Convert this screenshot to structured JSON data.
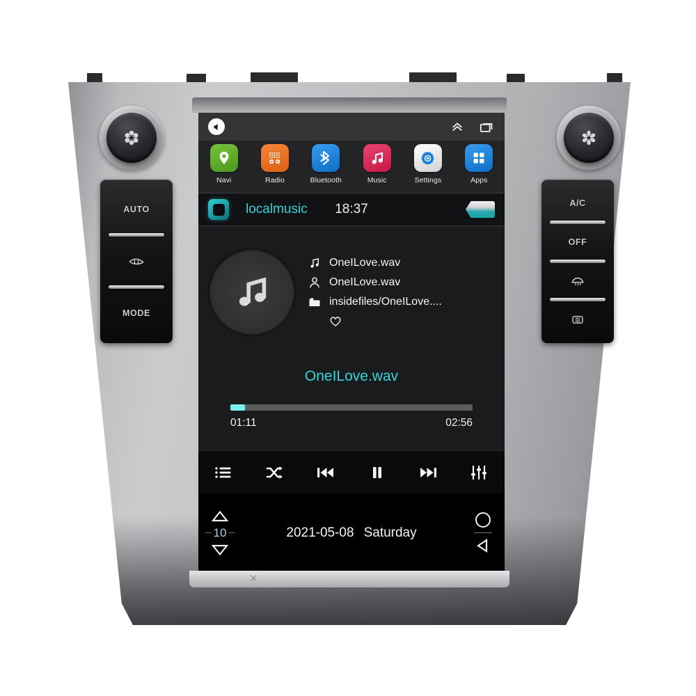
{
  "device": {
    "name": "car-head-unit",
    "bezel_color": "#bcbec0"
  },
  "hardware": {
    "left_knob": {
      "icon": "fan-icon",
      "label": ""
    },
    "right_knob": {
      "icon": "flower-fan-icon",
      "label": ""
    },
    "left_buttons": [
      {
        "label": "AUTO",
        "icon": ""
      },
      {
        "label": "",
        "icon": "rear-defrost-icon"
      },
      {
        "label": "MODE",
        "icon": ""
      }
    ],
    "right_buttons": [
      {
        "label": "A/C",
        "icon": ""
      },
      {
        "label": "OFF",
        "icon": ""
      },
      {
        "label": "",
        "icon": "front-defrost-icon"
      },
      {
        "label": "",
        "icon": "rear-window-defrost-icon"
      }
    ]
  },
  "status_bar": {
    "volume_icon": "speaker-icon",
    "expand_icon": "double-chevron-up-icon",
    "recents_icon": "recent-apps-icon"
  },
  "app_dock": [
    {
      "label": "Navi",
      "icon": "map-pin-icon",
      "color": "#5aab2a"
    },
    {
      "label": "Radio",
      "icon": "radio-icon",
      "color": "#e8721f"
    },
    {
      "label": "Bluetooth",
      "icon": "bluetooth-icon",
      "color": "#1880d8"
    },
    {
      "label": "Music",
      "icon": "music-note-icon",
      "color": "#d8265a"
    },
    {
      "label": "Settings",
      "icon": "gear-icon",
      "color": "#e9ebec"
    },
    {
      "label": "Apps",
      "icon": "grid-apps-icon",
      "color": "#1880d8"
    }
  ],
  "media_bar": {
    "home_icon": "home-square-icon",
    "source": "localmusic",
    "clock": "18:37",
    "back_icon": "back-arrow-chip"
  },
  "now_playing": {
    "album_art_icon": "music-note-icon",
    "title_row": {
      "icon": "music-note-icon",
      "text": "OneILove.wav"
    },
    "artist_row": {
      "icon": "person-icon",
      "text": "OneILove.wav"
    },
    "path_row": {
      "icon": "folder-icon",
      "text": "insidefiles/OneILove...."
    },
    "favorite_icon": "heart-icon",
    "track_title": "OneILove.wav",
    "accent_color": "#37d4d8"
  },
  "progress": {
    "elapsed": "01:11",
    "total": "02:56",
    "percent": 6,
    "fill_color": "#7cf0ef"
  },
  "transport": [
    {
      "name": "playlist-button",
      "icon": "list-icon"
    },
    {
      "name": "shuffle-button",
      "icon": "shuffle-icon"
    },
    {
      "name": "previous-button",
      "icon": "previous-track-icon"
    },
    {
      "name": "pause-button",
      "icon": "pause-icon"
    },
    {
      "name": "next-button",
      "icon": "next-track-icon"
    },
    {
      "name": "equalizer-button",
      "icon": "equalizer-icon"
    }
  ],
  "bottom_nav": {
    "volume_up_icon": "triangle-up-icon",
    "volume_value": "10",
    "volume_down_icon": "triangle-down-icon",
    "date": "2021-05-08",
    "weekday": "Saturday",
    "home_icon": "circle-home-icon",
    "back_icon": "triangle-back-icon"
  }
}
